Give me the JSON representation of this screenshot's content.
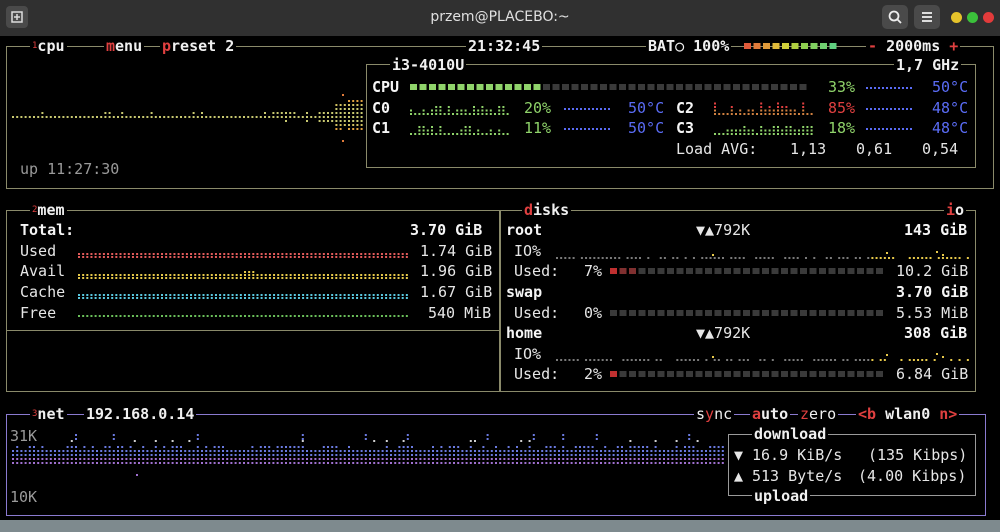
{
  "window": {
    "title": "przem@PLACEBO:~"
  },
  "cpu_box": {
    "number": "1",
    "title": "cpu",
    "menu_label": "menu",
    "preset_label": "preset 2",
    "clock": "21:32:45",
    "battery_label": "BAT○",
    "battery_pct": "100%",
    "battery_level": 1.0,
    "minus": "-",
    "interval": "2000ms",
    "plus": "+",
    "cpu_model": "i3-4010U",
    "freq": "1,7 GHz",
    "uptime": "up 11:27:30",
    "total": {
      "label": "CPU",
      "pct": "33%",
      "temp": "50°C",
      "level": 0.33
    },
    "cores": [
      {
        "label": "C0",
        "pct": "20%",
        "temp": "50°C"
      },
      {
        "label": "C1",
        "pct": "11%",
        "temp": "50°C"
      },
      {
        "label": "C2",
        "pct": "85%",
        "temp": "48°C"
      },
      {
        "label": "C3",
        "pct": "18%",
        "temp": "48°C"
      }
    ],
    "load_label": "Load AVG:",
    "load": [
      "1,13",
      "0,61",
      "0,54"
    ]
  },
  "mem_box": {
    "number": "2",
    "title": "mem",
    "total_label": "Total:",
    "total_value": "3.70 GiB",
    "rows": [
      {
        "label": "Used",
        "value": "1.74 GiB",
        "color": "#e05a5a"
      },
      {
        "label": "Avail",
        "value": "1.96 GiB",
        "color": "#e6c84a"
      },
      {
        "label": "Cache",
        "value": "1.67 GiB",
        "color": "#5ac8e0"
      },
      {
        "label": "Free",
        "value": "540 MiB",
        "color": "#6abf5a"
      }
    ]
  },
  "disks_box": {
    "title": "disks",
    "io_label": "io",
    "root": {
      "name": "root",
      "rate": "▼▲792K",
      "size": "143 GiB",
      "io_label": "IO%",
      "used_label": "Used:",
      "used_pct": "7%",
      "used_level": 0.07,
      "used_value": "10.2 GiB"
    },
    "swap": {
      "name": "swap",
      "size": "3.70 GiB",
      "used_label": "Used:",
      "used_pct": "0%",
      "used_level": 0.0,
      "used_value": "5.53 MiB"
    },
    "home": {
      "name": "home",
      "rate": "▼▲792K",
      "size": "308 GiB",
      "io_label": "IO%",
      "used_label": "Used:",
      "used_pct": "2%",
      "used_level": 0.02,
      "used_value": "6.84 GiB"
    }
  },
  "net_box": {
    "number": "3",
    "title": "net",
    "ip": "192.168.0.14",
    "sync_label": "sync",
    "auto_label": "auto",
    "zero_label": "zero",
    "prev_iface": "<b",
    "iface": "wlan0",
    "next_iface": "n>",
    "scale_top": "31K",
    "scale_bottom": "10K",
    "download_label": "download",
    "download_arrow": "▼",
    "download_rate": "16.9 KiB/s",
    "download_bits": "(135 Kibps)",
    "upload_arrow": "▲",
    "upload_rate": "513 Byte/s",
    "upload_bits": "(4.00 Kibps)",
    "upload_label": "upload"
  },
  "colors": {
    "border": "#8a8a6a",
    "net_border": "#8a7ad0",
    "accent_red": "#e04040",
    "cpu_green": "#8fd36a",
    "temp_blue": "#5a6cf5"
  }
}
